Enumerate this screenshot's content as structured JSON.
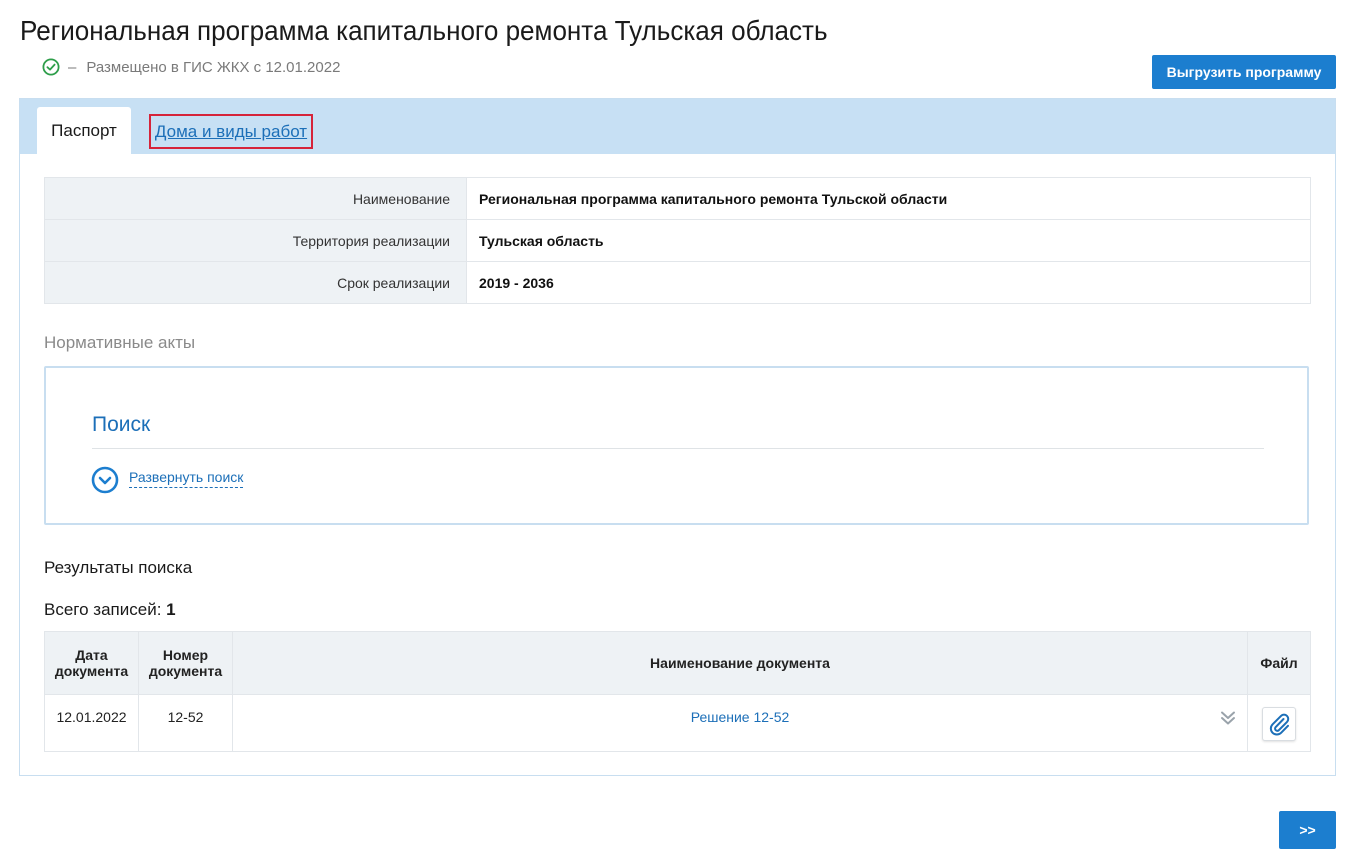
{
  "page": {
    "title": "Региональная программа капитального ремонта Тульская область",
    "status_dash": "–",
    "status_text": "Размещено в ГИС ЖКХ с 12.01.2022",
    "export_button": "Выгрузить программу",
    "next_button": ">>"
  },
  "tabs": [
    {
      "label": "Паспорт",
      "active": true
    },
    {
      "label": "Дома и виды работ",
      "active": false
    }
  ],
  "passport": [
    {
      "label": "Наименование",
      "value": "Региональная программа капитального ремонта Тульской области"
    },
    {
      "label": "Территория реализации",
      "value": "Тульская область"
    },
    {
      "label": "Срок реализации",
      "value": "2019 - 2036"
    }
  ],
  "normative": {
    "section_title": "Нормативные акты",
    "search_title": "Поиск",
    "expand_link": "Развернуть поиск"
  },
  "results": {
    "title": "Результаты поиска",
    "total_label": "Всего записей:",
    "total_count": "1",
    "columns": {
      "date": "Дата документа",
      "number": "Номер документа",
      "name": "Наименование документа",
      "file": "Файл"
    },
    "rows": [
      {
        "date": "12.01.2022",
        "number": "12-52",
        "name": "Решение 12-52"
      }
    ]
  },
  "colors": {
    "accent": "#1c7ecf",
    "link": "#1c6fb8",
    "tabbar": "#c7e0f4",
    "highlight_border": "#d6243a",
    "status_ok": "#2e9e4a"
  },
  "icons": {
    "status": "check-circle-icon",
    "expand": "chevron-down-circle-icon",
    "row_expand": "double-chevron-down-icon",
    "file": "paperclip-icon"
  }
}
